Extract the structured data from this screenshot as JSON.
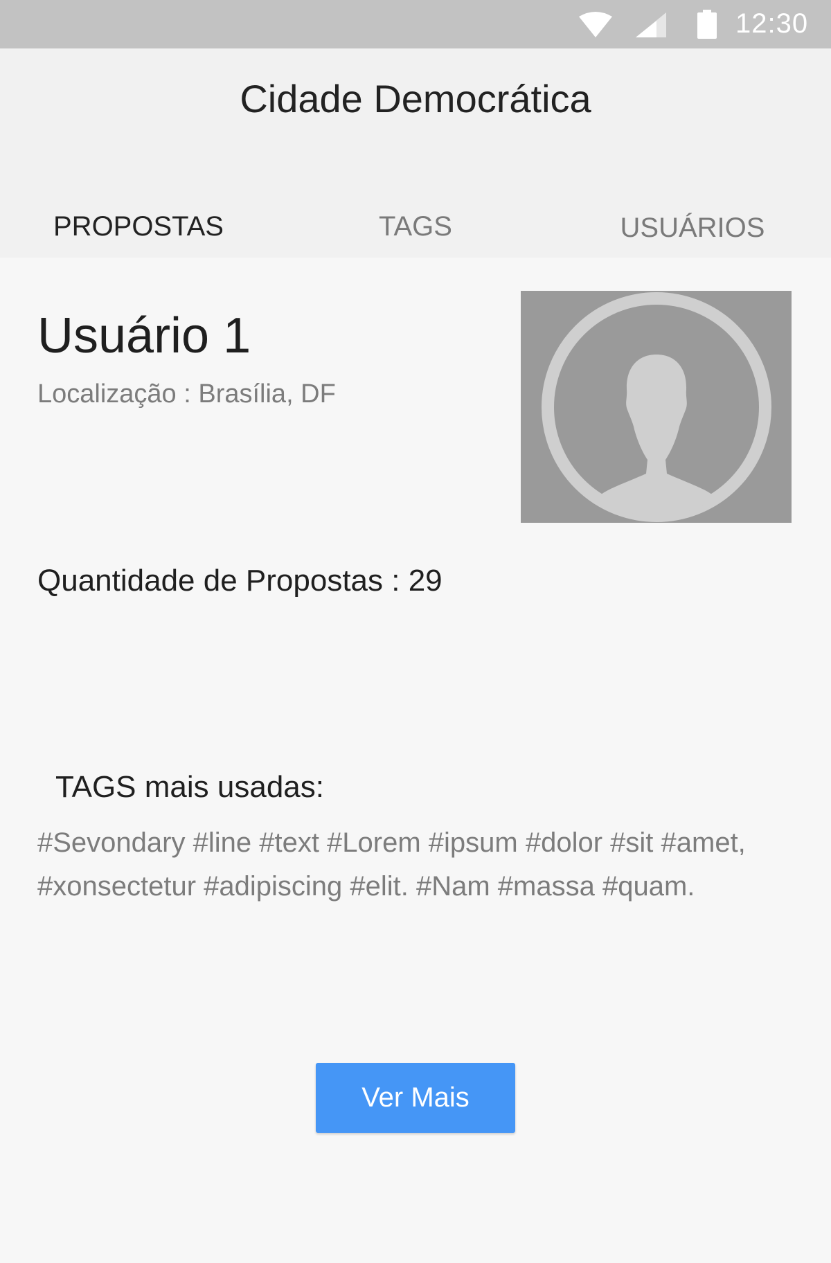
{
  "status_bar": {
    "time": "12:30",
    "icons": [
      "wifi-icon",
      "cell-signal-icon",
      "battery-icon"
    ]
  },
  "header": {
    "title": "Cidade Democrática"
  },
  "tabs": [
    {
      "label": "PROPOSTAS",
      "selected": true
    },
    {
      "label": "TAGS",
      "selected": false
    },
    {
      "label": "USUÁRIOS",
      "selected": false
    }
  ],
  "profile": {
    "name": "Usuário 1",
    "location": "Localização : Brasília, DF",
    "avatar_icon": "user-placeholder-icon",
    "proposals_count": "Quantidade de Propostas : 29"
  },
  "tags": {
    "heading": "TAGS mais usadas:",
    "text": "#Sevondary #line #text #Lorem #ipsum #dolor #sit #amet, #xonsectetur #adipiscing #elit. #Nam #massa #quam."
  },
  "actions": {
    "more_label": "Ver Mais"
  },
  "colors": {
    "status_bar": "#c2c2c2",
    "header": "#f1f1f1",
    "background": "#f7f7f7",
    "button": "#4596f6",
    "avatar_bg": "#9a9a9a",
    "avatar_fg": "#cfcfcf"
  }
}
